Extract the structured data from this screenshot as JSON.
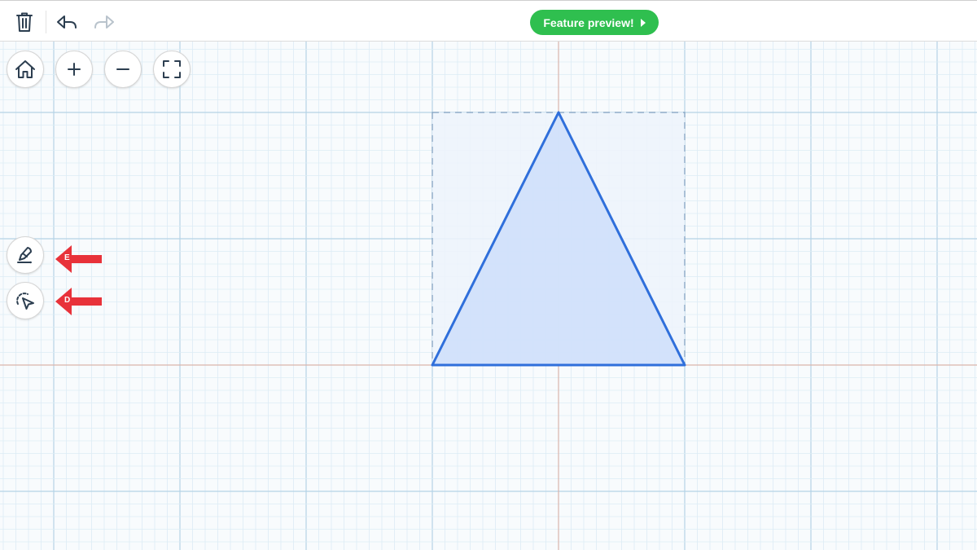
{
  "colors": {
    "grid_minor": "#dcecf5",
    "grid_major": "#b5d3e6",
    "axis": "#d9b5ad",
    "shape_stroke": "#2f6fdb",
    "shape_fill": "#cfe0fb",
    "bbox_fill": "#edf3fc",
    "bbox_stroke": "#7f9fbf",
    "preview_green": "#2fbf4f",
    "annotation_red": "#e8323a",
    "icon_dark": "#2c3e50",
    "icon_disabled": "#b9c3cc"
  },
  "toolbar": {
    "trash_icon": "trash-icon",
    "undo_icon": "undo-icon",
    "redo_icon": "redo-icon",
    "feature_preview_label": "Feature preview!"
  },
  "nav_controls": {
    "home_icon": "home-icon",
    "zoom_in_icon": "plus-icon",
    "zoom_out_icon": "minus-icon",
    "fullscreen_icon": "fullscreen-icon"
  },
  "tools": [
    {
      "icon": "pen-icon",
      "annotation": "E"
    },
    {
      "icon": "lasso-select-icon",
      "annotation": "D"
    }
  ],
  "shape": {
    "type": "triangle",
    "fill_visible": true,
    "bounding_box_dashed": true
  }
}
